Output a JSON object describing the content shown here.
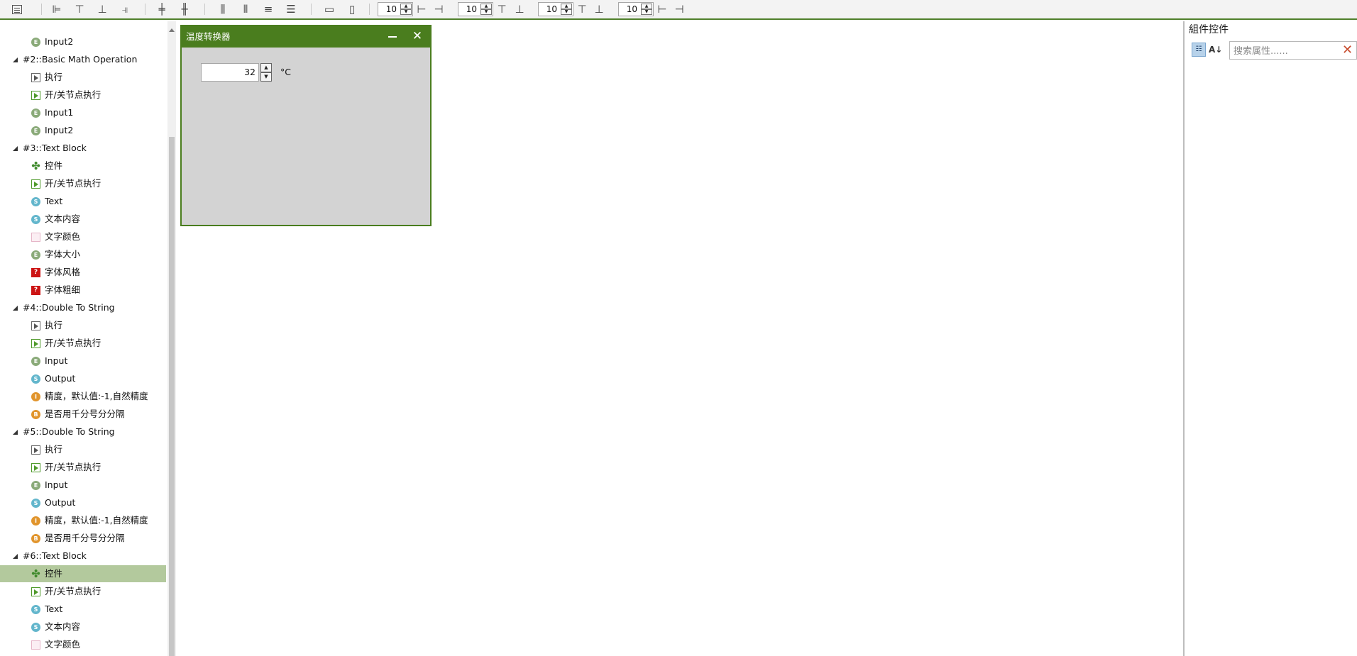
{
  "toolbar": {
    "spin_values": [
      "10",
      "10",
      "10",
      "10"
    ]
  },
  "tree": {
    "rows": [
      {
        "type": "item",
        "icon": "c-green",
        "glyph": "E",
        "label": "Input2"
      },
      {
        "type": "group",
        "label": "#2::Basic Math Operation"
      },
      {
        "type": "item",
        "icon": "play",
        "label": "执行"
      },
      {
        "type": "item",
        "icon": "toggle",
        "label": "开/关节点执行"
      },
      {
        "type": "item",
        "icon": "c-green",
        "glyph": "E",
        "label": "Input1"
      },
      {
        "type": "item",
        "icon": "c-green",
        "glyph": "E",
        "label": "Input2"
      },
      {
        "type": "group",
        "label": "#3::Text Block"
      },
      {
        "type": "item",
        "icon": "puzzle",
        "label": "控件"
      },
      {
        "type": "item",
        "icon": "toggle",
        "label": "开/关节点执行"
      },
      {
        "type": "item",
        "icon": "c-blue",
        "glyph": "S",
        "label": "Text"
      },
      {
        "type": "item",
        "icon": "c-blue",
        "glyph": "S",
        "label": "文本内容"
      },
      {
        "type": "item",
        "icon": "color",
        "label": "文字颜色"
      },
      {
        "type": "item",
        "icon": "c-green",
        "glyph": "E",
        "label": "字体大小"
      },
      {
        "type": "item",
        "icon": "red",
        "glyph": "?",
        "label": "字体风格"
      },
      {
        "type": "item",
        "icon": "red",
        "glyph": "?",
        "label": "字体粗细"
      },
      {
        "type": "group",
        "label": "#4::Double To String"
      },
      {
        "type": "item",
        "icon": "play",
        "label": "执行"
      },
      {
        "type": "item",
        "icon": "toggle",
        "label": "开/关节点执行"
      },
      {
        "type": "item",
        "icon": "c-green",
        "glyph": "E",
        "label": "Input"
      },
      {
        "type": "item",
        "icon": "c-blue",
        "glyph": "S",
        "label": "Output"
      },
      {
        "type": "item",
        "icon": "c-orange",
        "glyph": "I",
        "label": "精度，默认值:-1,自然精度"
      },
      {
        "type": "item",
        "icon": "c-orange",
        "glyph": "B",
        "label": "是否用千分号分分隔"
      },
      {
        "type": "group",
        "label": "#5::Double To String"
      },
      {
        "type": "item",
        "icon": "play",
        "label": "执行"
      },
      {
        "type": "item",
        "icon": "toggle",
        "label": "开/关节点执行"
      },
      {
        "type": "item",
        "icon": "c-green",
        "glyph": "E",
        "label": "Input"
      },
      {
        "type": "item",
        "icon": "c-blue",
        "glyph": "S",
        "label": "Output"
      },
      {
        "type": "item",
        "icon": "c-orange",
        "glyph": "I",
        "label": "精度，默认值:-1,自然精度"
      },
      {
        "type": "item",
        "icon": "c-orange",
        "glyph": "B",
        "label": "是否用千分号分分隔"
      },
      {
        "type": "group",
        "label": "#6::Text Block"
      },
      {
        "type": "item",
        "icon": "puzzle",
        "label": "控件",
        "selected": true
      },
      {
        "type": "item",
        "icon": "toggle",
        "label": "开/关节点执行"
      },
      {
        "type": "item",
        "icon": "c-blue",
        "glyph": "S",
        "label": "Text"
      },
      {
        "type": "item",
        "icon": "c-blue",
        "glyph": "S",
        "label": "文本内容"
      },
      {
        "type": "item",
        "icon": "color",
        "label": "文字颜色"
      }
    ]
  },
  "window": {
    "title": "温度转换器",
    "value": "32",
    "unit": "°C"
  },
  "props": {
    "title": "組件控件",
    "search_placeholder": "搜索属性......"
  }
}
